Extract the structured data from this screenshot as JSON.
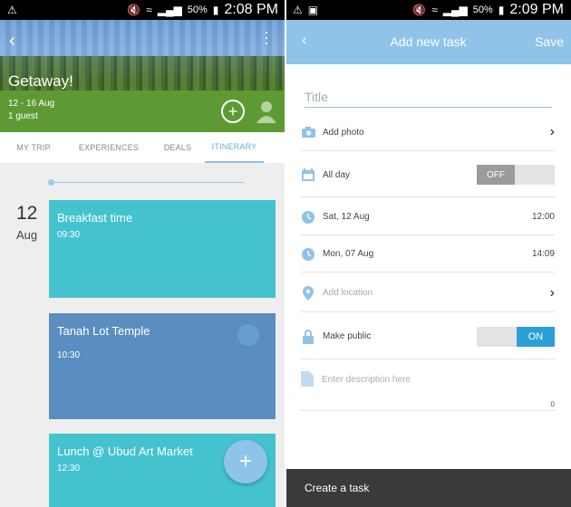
{
  "left": {
    "status": {
      "battery": "50%",
      "time": "2:08 PM"
    },
    "hero": {
      "trip_title": "Getaway!",
      "dates": "12 - 16 Aug",
      "guests": "1 guest"
    },
    "tabs": [
      {
        "label": "MY TRIP"
      },
      {
        "label": "EXPERIENCES"
      },
      {
        "label": "DEALS"
      },
      {
        "label": "ITINERARY"
      }
    ],
    "active_tab": "ITINERARY",
    "date": {
      "day": "12",
      "month": "Aug"
    },
    "cards": [
      {
        "title": "Breakfast time",
        "time": "09:30"
      },
      {
        "title": "Tanah Lot Temple",
        "time": "10:30"
      },
      {
        "title": "Lunch @ Ubud Art Market",
        "time": "12:30"
      }
    ],
    "fab": "+"
  },
  "right": {
    "status": {
      "battery": "50%",
      "time": "2:09 PM"
    },
    "appbar": {
      "title": "Add new task",
      "save": "Save"
    },
    "form": {
      "title_placeholder": "Title",
      "add_photo": "Add photo",
      "all_day": "All day",
      "all_day_state": "OFF",
      "start_date": "Sat, 12 Aug",
      "start_time": "12:00",
      "end_date": "Mon, 07 Aug",
      "end_time": "14:09",
      "add_location": "Add location",
      "make_public": "Make public",
      "make_public_state": "ON",
      "description_placeholder": "Enter description here",
      "char_count": "0"
    },
    "bottom_bar": "Create a task"
  },
  "colors": {
    "accent_blue": "#8fc3ea",
    "card_teal": "#44c3cf",
    "card_blue": "#5a8ec0",
    "toggle_on": "#2aa0d6",
    "bottom_bar": "#3a3a3a"
  }
}
